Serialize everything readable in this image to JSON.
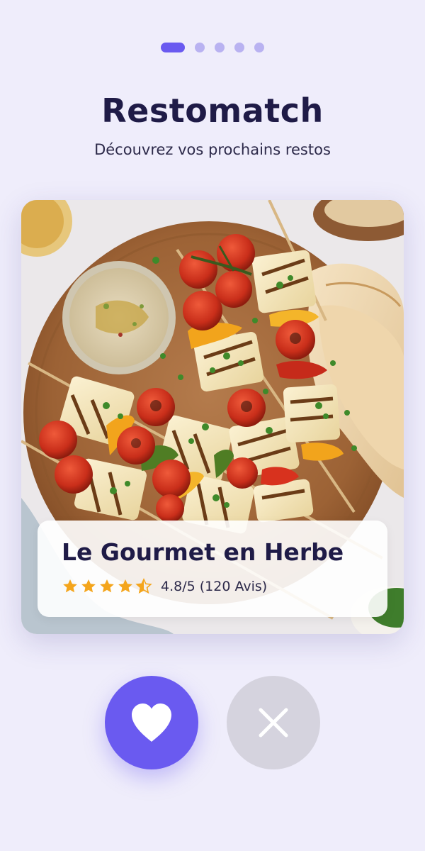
{
  "pager": {
    "count": 5,
    "active_index": 0
  },
  "header": {
    "title": "Restomatch",
    "subtitle": "Découvrez vos prochains restos"
  },
  "card": {
    "image": "grilled halloumi skewers with cherry tomatoes, peppers, pita and dip on a wooden board",
    "restaurant_name": "Le Gourmet en Herbe",
    "rating_value": 4.5,
    "rating_text": "4.8/5 (120 Avis)"
  },
  "actions": {
    "like_icon": "heart-icon",
    "dislike_icon": "close-icon"
  },
  "colors": {
    "accent": "#6a5af0",
    "background": "#efedfb",
    "star": "#f4a51c",
    "title": "#1f1b47"
  }
}
